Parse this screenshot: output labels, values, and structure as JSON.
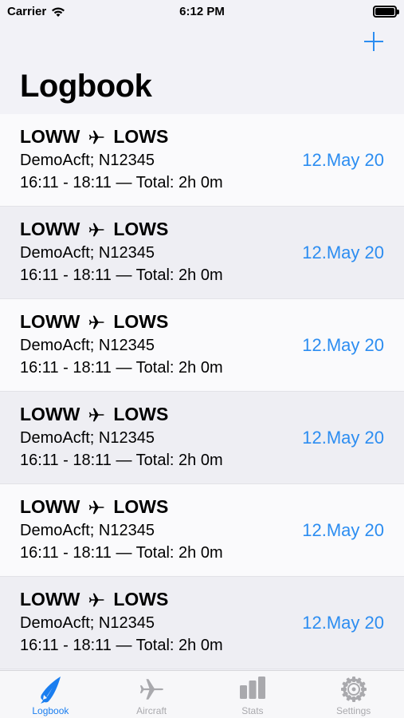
{
  "status": {
    "carrier": "Carrier",
    "time": "6:12 PM"
  },
  "header": {
    "title": "Logbook"
  },
  "entries": [
    {
      "from": "LOWW",
      "to": "LOWS",
      "aircraft": "DemoAcft; N12345",
      "times": "16:11 - 18:11  —  Total: 2h 0m",
      "date": "12.May 20"
    },
    {
      "from": "LOWW",
      "to": "LOWS",
      "aircraft": "DemoAcft; N12345",
      "times": "16:11 - 18:11  —  Total: 2h 0m",
      "date": "12.May 20"
    },
    {
      "from": "LOWW",
      "to": "LOWS",
      "aircraft": "DemoAcft; N12345",
      "times": "16:11 - 18:11  —  Total: 2h 0m",
      "date": "12.May 20"
    },
    {
      "from": "LOWW",
      "to": "LOWS",
      "aircraft": "DemoAcft; N12345",
      "times": "16:11 - 18:11  —  Total: 2h 0m",
      "date": "12.May 20"
    },
    {
      "from": "LOWW",
      "to": "LOWS",
      "aircraft": "DemoAcft; N12345",
      "times": "16:11 - 18:11  —  Total: 2h 0m",
      "date": "12.May 20"
    },
    {
      "from": "LOWW",
      "to": "LOWS",
      "aircraft": "DemoAcft; N12345",
      "times": "16:11 - 18:11  —  Total: 2h 0m",
      "date": "12.May 20"
    }
  ],
  "tabs": [
    {
      "label": "Logbook",
      "icon": "logbook-icon",
      "active": true
    },
    {
      "label": "Aircraft",
      "icon": "airplane-icon",
      "active": false
    },
    {
      "label": "Stats",
      "icon": "stats-icon",
      "active": false
    },
    {
      "label": "Settings",
      "icon": "gear-icon",
      "active": false
    }
  ],
  "colors": {
    "accent": "#2c8df1",
    "tab_active": "#1a7ef0",
    "tab_inactive": "#a9a9ad"
  }
}
